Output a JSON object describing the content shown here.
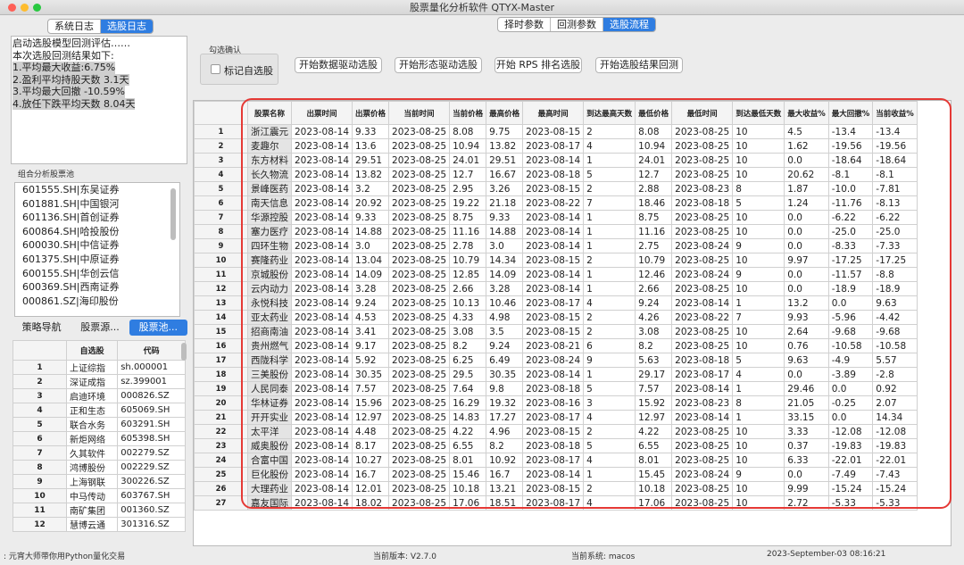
{
  "window": {
    "title": "股票量化分析软件 QTYX-Master"
  },
  "left_tabs": [
    "系统日志",
    "选股日志"
  ],
  "right_tabs": [
    "择时参数",
    "回测参数",
    "选股流程"
  ],
  "log_lines": [
    "启动选股模型回测评估……",
    "本次选股回测结果如下:",
    "1.平均最大收益:6.75%",
    "2.盈利平均持股天数 3.1天",
    "3.平均最大回撤 -10.59%",
    "4.放任下跌平均天数 8.04天"
  ],
  "pool_label": "组合分析股票池",
  "pool_items": [
    "601555.SH|东吴证券",
    "601881.SH|中国银河",
    "601136.SH|首创证券",
    "600864.SH|哈投股份",
    "600030.SH|中信证券",
    "601375.SH|中原证券",
    "600155.SH|华创云信",
    "600369.SH|西南证券",
    "000861.SZ|海印股份"
  ],
  "bottom_tabs": [
    "策略导航",
    "股票源...",
    "股票池..."
  ],
  "small_table": {
    "headers": [
      "",
      "自选股",
      "代码"
    ],
    "rows": [
      [
        "1",
        "上证综指",
        "sh.000001"
      ],
      [
        "2",
        "深证成指",
        "sz.399001"
      ],
      [
        "3",
        "启迪环境",
        "000826.SZ"
      ],
      [
        "4",
        "正和生态",
        "605069.SH"
      ],
      [
        "5",
        "联合水务",
        "603291.SH"
      ],
      [
        "6",
        "新炬网络",
        "605398.SH"
      ],
      [
        "7",
        "久其软件",
        "002279.SZ"
      ],
      [
        "8",
        "鸿博股份",
        "002229.SZ"
      ],
      [
        "9",
        "上海钢联",
        "300226.SZ"
      ],
      [
        "10",
        "中马传动",
        "603767.SH"
      ],
      [
        "11",
        "南矿集团",
        "001360.SZ"
      ],
      [
        "12",
        "慧博云通",
        "301316.SZ"
      ]
    ]
  },
  "confirm_group": {
    "title": "勾选确认",
    "checkbox_label": "标记自选股"
  },
  "action_buttons": [
    "开始数据驱动选股",
    "开始形态驱动选股",
    "开始 RPS 排名选股",
    "开始选股结果回测"
  ],
  "main_table": {
    "headers": [
      "",
      "股票名称",
      "出票时间",
      "出票价格",
      "当前时间",
      "当前价格",
      "最高价格",
      "最高时间",
      "到达最高天数",
      "最低价格",
      "最低时间",
      "到达最低天数",
      "最大收益%",
      "最大回撤%",
      "当前收益%"
    ],
    "rows": [
      [
        "1",
        "浙江震元",
        "2023-08-14",
        "9.33",
        "2023-08-25",
        "8.08",
        "9.75",
        "2023-08-15",
        "2",
        "8.08",
        "2023-08-25",
        "10",
        "4.5",
        "-13.4",
        "-13.4"
      ],
      [
        "2",
        "麦趣尔",
        "2023-08-14",
        "13.6",
        "2023-08-25",
        "10.94",
        "13.82",
        "2023-08-17",
        "4",
        "10.94",
        "2023-08-25",
        "10",
        "1.62",
        "-19.56",
        "-19.56"
      ],
      [
        "3",
        "东方材料",
        "2023-08-14",
        "29.51",
        "2023-08-25",
        "24.01",
        "29.51",
        "2023-08-14",
        "1",
        "24.01",
        "2023-08-25",
        "10",
        "0.0",
        "-18.64",
        "-18.64"
      ],
      [
        "4",
        "长久物流",
        "2023-08-14",
        "13.82",
        "2023-08-25",
        "12.7",
        "16.67",
        "2023-08-18",
        "5",
        "12.7",
        "2023-08-25",
        "10",
        "20.62",
        "-8.1",
        "-8.1"
      ],
      [
        "5",
        "景峰医药",
        "2023-08-14",
        "3.2",
        "2023-08-25",
        "2.95",
        "3.26",
        "2023-08-15",
        "2",
        "2.88",
        "2023-08-23",
        "8",
        "1.87",
        "-10.0",
        "-7.81"
      ],
      [
        "6",
        "南天信息",
        "2023-08-14",
        "20.92",
        "2023-08-25",
        "19.22",
        "21.18",
        "2023-08-22",
        "7",
        "18.46",
        "2023-08-18",
        "5",
        "1.24",
        "-11.76",
        "-8.13"
      ],
      [
        "7",
        "华源控股",
        "2023-08-14",
        "9.33",
        "2023-08-25",
        "8.75",
        "9.33",
        "2023-08-14",
        "1",
        "8.75",
        "2023-08-25",
        "10",
        "0.0",
        "-6.22",
        "-6.22"
      ],
      [
        "8",
        "塞力医疗",
        "2023-08-14",
        "14.88",
        "2023-08-25",
        "11.16",
        "14.88",
        "2023-08-14",
        "1",
        "11.16",
        "2023-08-25",
        "10",
        "0.0",
        "-25.0",
        "-25.0"
      ],
      [
        "9",
        "四环生物",
        "2023-08-14",
        "3.0",
        "2023-08-25",
        "2.78",
        "3.0",
        "2023-08-14",
        "1",
        "2.75",
        "2023-08-24",
        "9",
        "0.0",
        "-8.33",
        "-7.33"
      ],
      [
        "10",
        "赛隆药业",
        "2023-08-14",
        "13.04",
        "2023-08-25",
        "10.79",
        "14.34",
        "2023-08-15",
        "2",
        "10.79",
        "2023-08-25",
        "10",
        "9.97",
        "-17.25",
        "-17.25"
      ],
      [
        "11",
        "京城股份",
        "2023-08-14",
        "14.09",
        "2023-08-25",
        "12.85",
        "14.09",
        "2023-08-14",
        "1",
        "12.46",
        "2023-08-24",
        "9",
        "0.0",
        "-11.57",
        "-8.8"
      ],
      [
        "12",
        "云内动力",
        "2023-08-14",
        "3.28",
        "2023-08-25",
        "2.66",
        "3.28",
        "2023-08-14",
        "1",
        "2.66",
        "2023-08-25",
        "10",
        "0.0",
        "-18.9",
        "-18.9"
      ],
      [
        "13",
        "永悦科技",
        "2023-08-14",
        "9.24",
        "2023-08-25",
        "10.13",
        "10.46",
        "2023-08-17",
        "4",
        "9.24",
        "2023-08-14",
        "1",
        "13.2",
        "0.0",
        "9.63"
      ],
      [
        "14",
        "亚太药业",
        "2023-08-14",
        "4.53",
        "2023-08-25",
        "4.33",
        "4.98",
        "2023-08-15",
        "2",
        "4.26",
        "2023-08-22",
        "7",
        "9.93",
        "-5.96",
        "-4.42"
      ],
      [
        "15",
        "招商南油",
        "2023-08-14",
        "3.41",
        "2023-08-25",
        "3.08",
        "3.5",
        "2023-08-15",
        "2",
        "3.08",
        "2023-08-25",
        "10",
        "2.64",
        "-9.68",
        "-9.68"
      ],
      [
        "16",
        "贵州燃气",
        "2023-08-14",
        "9.17",
        "2023-08-25",
        "8.2",
        "9.24",
        "2023-08-21",
        "6",
        "8.2",
        "2023-08-25",
        "10",
        "0.76",
        "-10.58",
        "-10.58"
      ],
      [
        "17",
        "西陇科学",
        "2023-08-14",
        "5.92",
        "2023-08-25",
        "6.25",
        "6.49",
        "2023-08-24",
        "9",
        "5.63",
        "2023-08-18",
        "5",
        "9.63",
        "-4.9",
        "5.57"
      ],
      [
        "18",
        "三美股份",
        "2023-08-14",
        "30.35",
        "2023-08-25",
        "29.5",
        "30.35",
        "2023-08-14",
        "1",
        "29.17",
        "2023-08-17",
        "4",
        "0.0",
        "-3.89",
        "-2.8"
      ],
      [
        "19",
        "人民同泰",
        "2023-08-14",
        "7.57",
        "2023-08-25",
        "7.64",
        "9.8",
        "2023-08-18",
        "5",
        "7.57",
        "2023-08-14",
        "1",
        "29.46",
        "0.0",
        "0.92"
      ],
      [
        "20",
        "华林证券",
        "2023-08-14",
        "15.96",
        "2023-08-25",
        "16.29",
        "19.32",
        "2023-08-16",
        "3",
        "15.92",
        "2023-08-23",
        "8",
        "21.05",
        "-0.25",
        "2.07"
      ],
      [
        "21",
        "开开实业",
        "2023-08-14",
        "12.97",
        "2023-08-25",
        "14.83",
        "17.27",
        "2023-08-17",
        "4",
        "12.97",
        "2023-08-14",
        "1",
        "33.15",
        "0.0",
        "14.34"
      ],
      [
        "22",
        "太平洋",
        "2023-08-14",
        "4.48",
        "2023-08-25",
        "4.22",
        "4.96",
        "2023-08-15",
        "2",
        "4.22",
        "2023-08-25",
        "10",
        "3.33",
        "-12.08",
        "-12.08"
      ],
      [
        "23",
        "威奥股份",
        "2023-08-14",
        "8.17",
        "2023-08-25",
        "6.55",
        "8.2",
        "2023-08-18",
        "5",
        "6.55",
        "2023-08-25",
        "10",
        "0.37",
        "-19.83",
        "-19.83"
      ],
      [
        "24",
        "合富中国",
        "2023-08-14",
        "10.27",
        "2023-08-25",
        "8.01",
        "10.92",
        "2023-08-17",
        "4",
        "8.01",
        "2023-08-25",
        "10",
        "6.33",
        "-22.01",
        "-22.01"
      ],
      [
        "25",
        "巨化股份",
        "2023-08-14",
        "16.7",
        "2023-08-25",
        "15.46",
        "16.7",
        "2023-08-14",
        "1",
        "15.45",
        "2023-08-24",
        "9",
        "0.0",
        "-7.49",
        "-7.43"
      ],
      [
        "26",
        "大理药业",
        "2023-08-14",
        "12.01",
        "2023-08-25",
        "10.18",
        "13.21",
        "2023-08-15",
        "2",
        "10.18",
        "2023-08-25",
        "10",
        "9.99",
        "-15.24",
        "-15.24"
      ],
      [
        "27",
        "嘉友国际",
        "2023-08-14",
        "18.02",
        "2023-08-25",
        "17.06",
        "18.51",
        "2023-08-17",
        "4",
        "17.06",
        "2023-08-25",
        "10",
        "2.72",
        "-5.33",
        "-5.33"
      ]
    ]
  },
  "status_bar": {
    "left": ": 元宵大师带你用Python量化交易",
    "version": "当前版本: V2.7.0",
    "system": "当前系统: macos",
    "datetime": "2023-September-03 08:16:21"
  },
  "colors": {
    "accent": "#2f7de1",
    "highlight_box": "#e53935",
    "traffic_red": "#fe5f57",
    "traffic_yellow": "#febc2e",
    "traffic_green": "#28c840"
  }
}
